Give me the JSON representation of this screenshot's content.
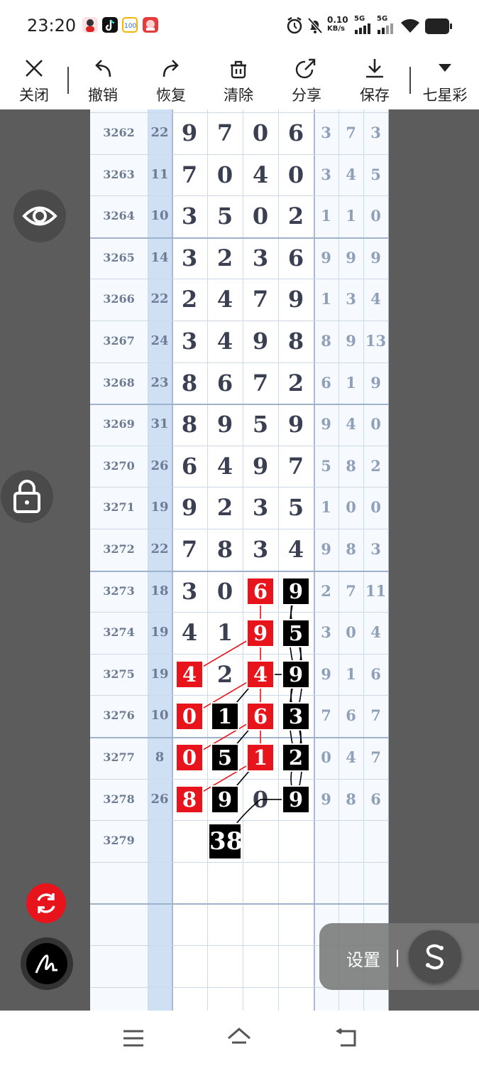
{
  "status_bar": {
    "time": "23:20",
    "net_speed_value": "0.10",
    "net_speed_unit": "KB/s",
    "signal1": "5G",
    "signal2": "5G"
  },
  "toolbar": {
    "close": "关闭",
    "undo": "撤销",
    "redo": "恢复",
    "clear": "清除",
    "share": "分享",
    "save": "保存",
    "lottery": "七星彩"
  },
  "grid": {
    "rows": [
      {
        "id": "3262",
        "sum": "22",
        "d": [
          "9",
          "7",
          "0",
          "6"
        ],
        "e": [
          "3",
          "7",
          "3"
        ]
      },
      {
        "id": "3263",
        "sum": "11",
        "d": [
          "7",
          "0",
          "4",
          "0"
        ],
        "e": [
          "3",
          "4",
          "5"
        ]
      },
      {
        "id": "3264",
        "sum": "10",
        "d": [
          "3",
          "5",
          "0",
          "2"
        ],
        "e": [
          "1",
          "1",
          "0"
        ]
      },
      {
        "id": "3265",
        "sum": "14",
        "d": [
          "3",
          "2",
          "3",
          "6"
        ],
        "e": [
          "9",
          "9",
          "9"
        ]
      },
      {
        "id": "3266",
        "sum": "22",
        "d": [
          "2",
          "4",
          "7",
          "9"
        ],
        "e": [
          "1",
          "3",
          "4"
        ]
      },
      {
        "id": "3267",
        "sum": "24",
        "d": [
          "3",
          "4",
          "9",
          "8"
        ],
        "e": [
          "8",
          "9",
          "13"
        ]
      },
      {
        "id": "3268",
        "sum": "23",
        "d": [
          "8",
          "6",
          "7",
          "2"
        ],
        "e": [
          "6",
          "1",
          "9"
        ]
      },
      {
        "id": "3269",
        "sum": "31",
        "d": [
          "8",
          "9",
          "5",
          "9"
        ],
        "e": [
          "9",
          "4",
          "0"
        ]
      },
      {
        "id": "3270",
        "sum": "26",
        "d": [
          "6",
          "4",
          "9",
          "7"
        ],
        "e": [
          "5",
          "8",
          "2"
        ]
      },
      {
        "id": "3271",
        "sum": "19",
        "d": [
          "9",
          "2",
          "3",
          "5"
        ],
        "e": [
          "1",
          "0",
          "0"
        ]
      },
      {
        "id": "3272",
        "sum": "22",
        "d": [
          "7",
          "8",
          "3",
          "4"
        ],
        "e": [
          "9",
          "8",
          "3"
        ]
      },
      {
        "id": "3273",
        "sum": "18",
        "d": [
          "3",
          "0",
          "6",
          "9"
        ],
        "e": [
          "2",
          "7",
          "11"
        ]
      },
      {
        "id": "3274",
        "sum": "19",
        "d": [
          "4",
          "1",
          "9",
          "5"
        ],
        "e": [
          "3",
          "0",
          "4"
        ]
      },
      {
        "id": "3275",
        "sum": "19",
        "d": [
          "4",
          "2",
          "4",
          "9"
        ],
        "e": [
          "9",
          "1",
          "6"
        ]
      },
      {
        "id": "3276",
        "sum": "10",
        "d": [
          "0",
          "1",
          "6",
          "3"
        ],
        "e": [
          "7",
          "6",
          "7"
        ]
      },
      {
        "id": "3277",
        "sum": "8",
        "d": [
          "0",
          "5",
          "1",
          "2"
        ],
        "e": [
          "0",
          "4",
          "7"
        ]
      },
      {
        "id": "3278",
        "sum": "26",
        "d": [
          "8",
          "9",
          "0",
          "9"
        ],
        "e": [
          "9",
          "8",
          "6"
        ]
      },
      {
        "id": "3279",
        "sum": "",
        "d": [
          "",
          "",
          "",
          ""
        ],
        "e": [
          "",
          "",
          ""
        ]
      }
    ],
    "marks": [
      {
        "row": 11,
        "col": 2,
        "color": "red"
      },
      {
        "row": 11,
        "col": 3,
        "color": "black"
      },
      {
        "row": 12,
        "col": 2,
        "color": "red"
      },
      {
        "row": 12,
        "col": 3,
        "color": "black"
      },
      {
        "row": 13,
        "col": 0,
        "color": "red"
      },
      {
        "row": 13,
        "col": 2,
        "color": "red"
      },
      {
        "row": 13,
        "col": 3,
        "color": "black"
      },
      {
        "row": 14,
        "col": 0,
        "color": "red"
      },
      {
        "row": 14,
        "col": 1,
        "color": "black"
      },
      {
        "row": 14,
        "col": 2,
        "color": "red"
      },
      {
        "row": 14,
        "col": 3,
        "color": "black"
      },
      {
        "row": 15,
        "col": 0,
        "color": "red"
      },
      {
        "row": 15,
        "col": 1,
        "color": "black"
      },
      {
        "row": 15,
        "col": 2,
        "color": "red"
      },
      {
        "row": 15,
        "col": 3,
        "color": "black"
      },
      {
        "row": 16,
        "col": 0,
        "color": "red"
      },
      {
        "row": 16,
        "col": 1,
        "color": "black"
      },
      {
        "row": 16,
        "col": 3,
        "color": "black"
      }
    ],
    "prediction": "38",
    "mark_colors": {
      "red": "#e8141b",
      "black": "#000000"
    }
  },
  "settings_pill": {
    "label": "设置",
    "separator": "|"
  },
  "colors": {
    "side_gray": "#5c5c5c",
    "sum_column": "#cfe0f4",
    "refresh_button": "#e8141b"
  }
}
